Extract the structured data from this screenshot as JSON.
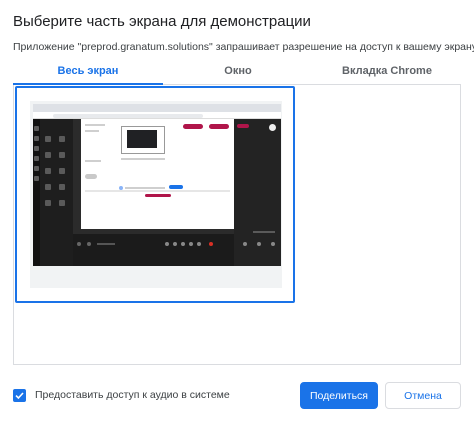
{
  "dialog": {
    "title": "Выберите часть экрана для демонстрации",
    "subtitle": "Приложение \"preprod.granatum.solutions\" запрашивает разрешение на доступ к вашему экрану.",
    "tabs": [
      {
        "label": "Весь экран",
        "active": true
      },
      {
        "label": "Окно",
        "active": false
      },
      {
        "label": "Вкладка Chrome",
        "active": false
      }
    ],
    "audio_checkbox": {
      "label": "Предоставить доступ к аудио в системе",
      "checked": true
    },
    "buttons": {
      "share": "Поделиться",
      "cancel": "Отмена"
    }
  },
  "colors": {
    "accent": "#1a73e8",
    "brand_crimson": "#b0154a",
    "divider": "#dadce0"
  }
}
